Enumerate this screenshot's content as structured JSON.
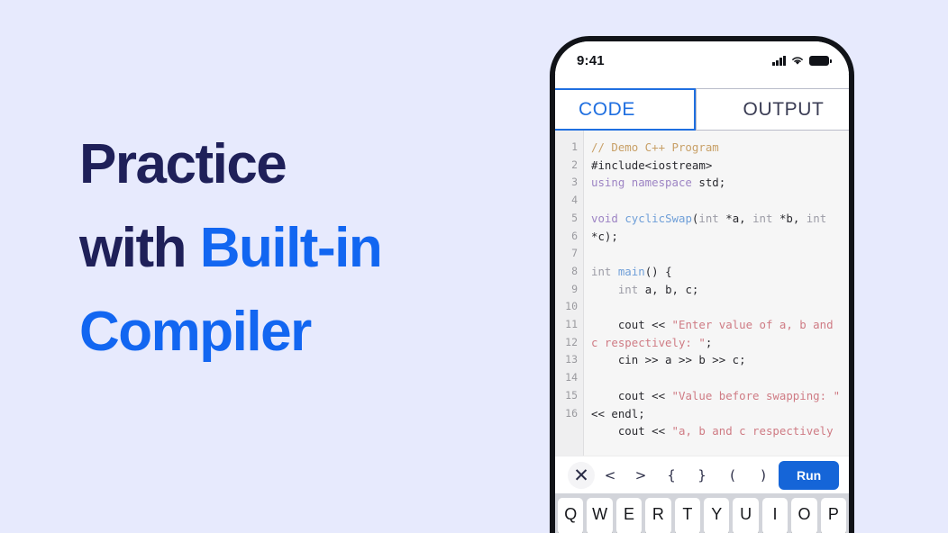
{
  "theme": {
    "background": "#e7eafd",
    "headline_dark": "#1f2059",
    "headline_accent": "#1266f1",
    "run_button": "#1565d8",
    "tab_active": "#1f6fe0"
  },
  "promo": {
    "line1_plain": "Practice",
    "line2_plain": "with ",
    "line2_accent": "Built-in",
    "line3_accent": "Compiler"
  },
  "phone": {
    "status": {
      "time": "9:41",
      "signal_icon": "signal-bars-icon",
      "wifi_icon": "wifi-icon",
      "battery_icon": "battery-icon"
    },
    "tabs": [
      {
        "label": "CODE",
        "active": true
      },
      {
        "label": "OUTPUT",
        "active": false
      }
    ],
    "editor": {
      "language": "C++",
      "line_numbers": [
        "1",
        "2",
        "3",
        "4",
        "5",
        "",
        "6",
        "7",
        "8",
        "9",
        "10",
        "",
        "11",
        "12",
        "13",
        "14",
        "15",
        "16"
      ],
      "lines": [
        {
          "n": "1",
          "tokens": [
            {
              "t": "// Demo C++ Program",
              "c": "cmt"
            }
          ]
        },
        {
          "n": "2",
          "tokens": [
            {
              "t": "#include<iostream>",
              "c": "pln"
            }
          ]
        },
        {
          "n": "3",
          "tokens": [
            {
              "t": "using namespace ",
              "c": "kw"
            },
            {
              "t": "std;",
              "c": "pln"
            }
          ]
        },
        {
          "n": "4",
          "tokens": []
        },
        {
          "n": "5",
          "tokens": [
            {
              "t": "void ",
              "c": "kw"
            },
            {
              "t": "cyclicSwap",
              "c": "fn"
            },
            {
              "t": "(",
              "c": "pln"
            },
            {
              "t": "int",
              "c": "typ"
            },
            {
              "t": " *a, ",
              "c": "pln"
            },
            {
              "t": "int",
              "c": "typ"
            },
            {
              "t": " *b, ",
              "c": "pln"
            },
            {
              "t": "int",
              "c": "typ"
            },
            {
              "t": " *c);",
              "c": "pln"
            }
          ]
        },
        {
          "n": "6",
          "tokens": []
        },
        {
          "n": "7",
          "tokens": [
            {
              "t": "int ",
              "c": "typ"
            },
            {
              "t": "main",
              "c": "fn"
            },
            {
              "t": "() {",
              "c": "pln"
            }
          ]
        },
        {
          "n": "8",
          "tokens": [
            {
              "t": "    ",
              "c": "pln"
            },
            {
              "t": "int",
              "c": "typ"
            },
            {
              "t": " a, b, c;",
              "c": "pln"
            }
          ]
        },
        {
          "n": "9",
          "tokens": []
        },
        {
          "n": "10",
          "tokens": [
            {
              "t": "    cout << ",
              "c": "pln"
            },
            {
              "t": "\"Enter value of a, b and c respectively: \"",
              "c": "str"
            },
            {
              "t": ";",
              "c": "pln"
            }
          ]
        },
        {
          "n": "11",
          "tokens": [
            {
              "t": "    cin >> a >> b >> c;",
              "c": "pln"
            }
          ]
        },
        {
          "n": "12",
          "tokens": []
        },
        {
          "n": "13",
          "tokens": [
            {
              "t": "    cout << ",
              "c": "pln"
            },
            {
              "t": "\"Value before swapping: \"",
              "c": "str"
            },
            {
              "t": " << endl;",
              "c": "pln"
            }
          ]
        },
        {
          "n": "15",
          "tokens": [
            {
              "t": "    cout << ",
              "c": "pln"
            },
            {
              "t": "\"a, b and c respectively",
              "c": "str"
            }
          ]
        }
      ]
    },
    "symbol_toolbar": {
      "close_icon": "close-icon",
      "keys": [
        "<",
        ">",
        "{",
        "}",
        "(",
        ")"
      ],
      "run_label": "Run"
    },
    "keyboard": {
      "row1": [
        "Q",
        "W",
        "E",
        "R",
        "T",
        "Y",
        "U",
        "I",
        "O",
        "P"
      ]
    }
  }
}
